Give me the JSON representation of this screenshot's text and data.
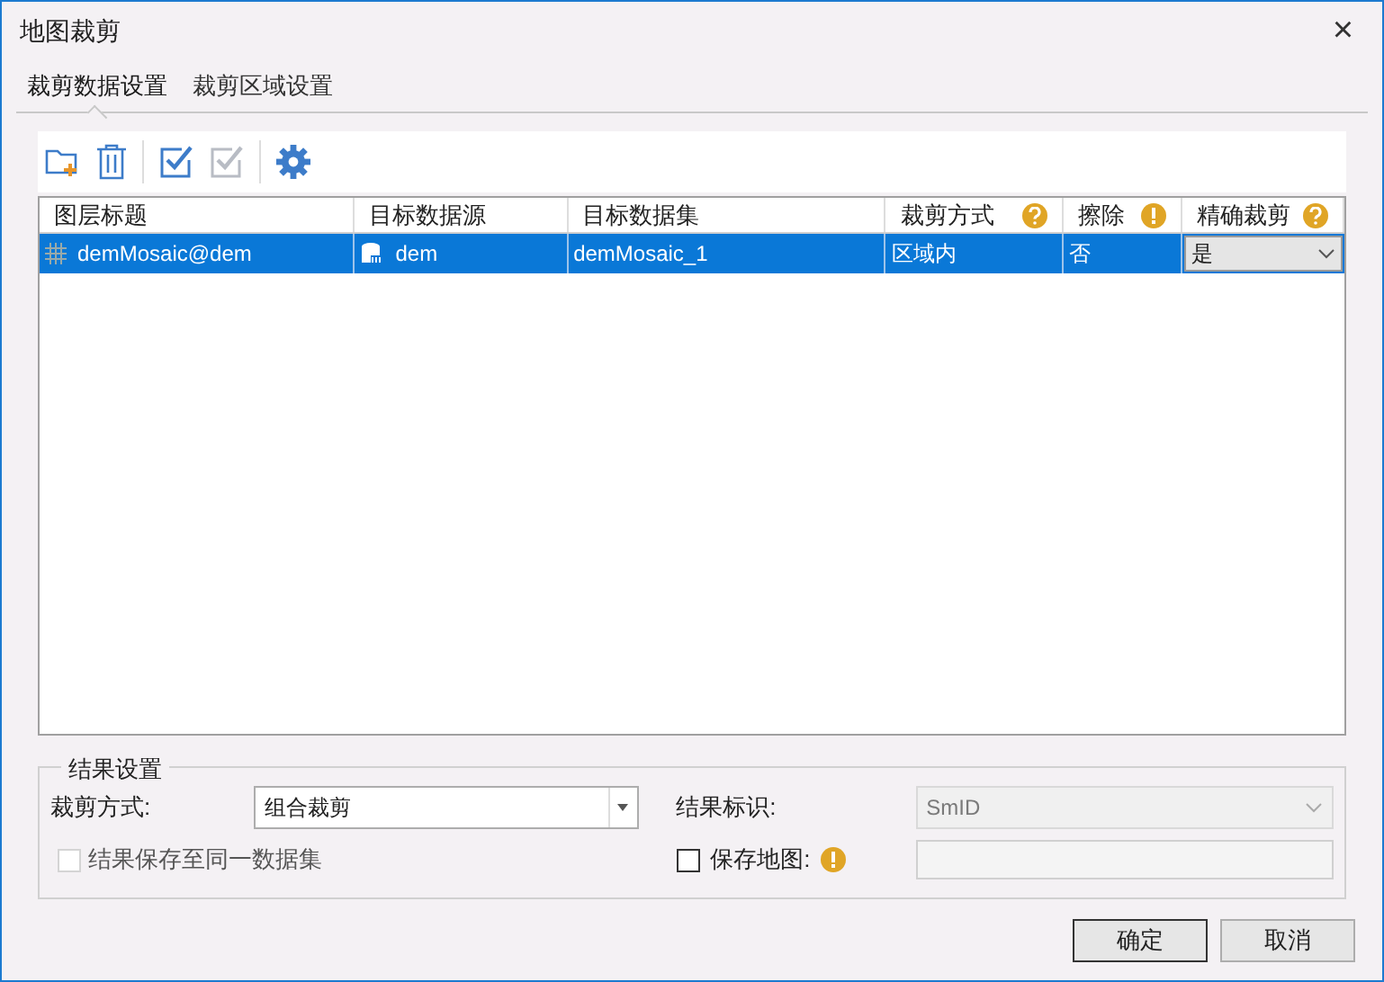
{
  "window": {
    "title": "地图裁剪",
    "close": "×"
  },
  "tabs": [
    {
      "label": "裁剪数据设置",
      "selected": true
    },
    {
      "label": "裁剪区域设置",
      "selected": false
    }
  ],
  "toolbar": [
    {
      "kind": "add-folder",
      "disabled": false
    },
    {
      "kind": "delete",
      "disabled": false
    },
    {
      "kind": "select-all",
      "disabled": false
    },
    {
      "kind": "invert",
      "disabled": true
    },
    {
      "kind": "settings",
      "disabled": false
    }
  ],
  "table": {
    "columns": [
      {
        "label": "图层标题",
        "kind": "plain"
      },
      {
        "label": "目标数据源",
        "kind": "plain"
      },
      {
        "label": "目标数据集",
        "kind": "plain"
      },
      {
        "label": "裁剪方式",
        "kind": "question"
      },
      {
        "label": "擦除",
        "kind": "warning"
      },
      {
        "label": "精确裁剪",
        "kind": "question"
      }
    ],
    "rows": [
      {
        "selected": true,
        "layer": "demMosaic@dem",
        "source": "dem",
        "dataset": "demMosaic_1",
        "mode": "区域内",
        "erase": "否",
        "exact": "是"
      }
    ]
  },
  "result": {
    "title": "结果设置",
    "mode_label": "裁剪方式:",
    "mode_value": "组合裁剪",
    "id_label": "结果标识:",
    "id_value": "SmID",
    "id_disabled": true,
    "same_dataset": {
      "label": "结果保存至同一数据集",
      "checked": false,
      "disabled": true
    },
    "save_map": {
      "label": "保存地图:",
      "checked": false,
      "disabled": false
    }
  },
  "buttons": [
    "确定",
    "取消"
  ]
}
